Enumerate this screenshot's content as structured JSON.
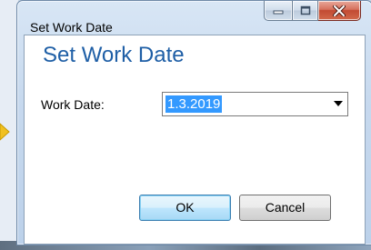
{
  "window": {
    "title": "Set Work Date",
    "minimize_glyph": "—",
    "maximize_glyph": "□",
    "close_glyph": "X"
  },
  "dialog": {
    "heading": "Set Work Date",
    "work_date_label": "Work Date:",
    "work_date_value": "1.3.2019",
    "ok_label": "OK",
    "cancel_label": "Cancel"
  },
  "icons": {
    "dropdown": "chevron-down-icon",
    "minimize": "minimize-icon",
    "maximize": "maximize-icon",
    "close": "close-icon"
  },
  "colors": {
    "heading": "#1f5fa6",
    "selection": "#3399ff",
    "close_button": "#c24a32"
  }
}
